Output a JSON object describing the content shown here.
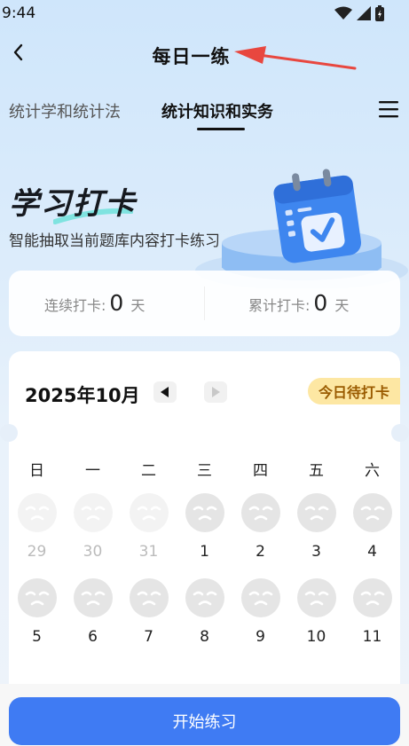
{
  "status": {
    "time": "9:44"
  },
  "nav": {
    "title": "每日一练"
  },
  "tabs": [
    {
      "label": "统计学和统计法",
      "active": false
    },
    {
      "label": "统计知识和实务",
      "active": true
    }
  ],
  "hero": {
    "title": "学习打卡",
    "subtitle": "智能抽取当前题库内容打卡练习"
  },
  "stats": {
    "streak_label": "连续打卡:",
    "streak_value": "0",
    "streak_unit": "天",
    "total_label": "累计打卡:",
    "total_value": "0",
    "total_unit": "天"
  },
  "calendar": {
    "month": "2025年10月",
    "badge": "今日待打卡",
    "weekdays": [
      "日",
      "一",
      "二",
      "三",
      "四",
      "五",
      "六"
    ],
    "days": [
      {
        "num": "29",
        "faded": true
      },
      {
        "num": "30",
        "faded": true
      },
      {
        "num": "31",
        "faded": true
      },
      {
        "num": "1",
        "faded": false
      },
      {
        "num": "2",
        "faded": false
      },
      {
        "num": "3",
        "faded": false
      },
      {
        "num": "4",
        "faded": false
      },
      {
        "num": "5",
        "faded": false
      },
      {
        "num": "6",
        "faded": false
      },
      {
        "num": "7",
        "faded": false
      },
      {
        "num": "8",
        "faded": false
      },
      {
        "num": "9",
        "faded": false
      },
      {
        "num": "10",
        "faded": false
      },
      {
        "num": "11",
        "faded": false
      }
    ]
  },
  "actions": {
    "start_label": "开始练习"
  },
  "colors": {
    "primary": "#3f7bf3",
    "badge_bg": "#fde7a3",
    "badge_text": "#9a5b00",
    "annotation_arrow": "#e8473f"
  }
}
